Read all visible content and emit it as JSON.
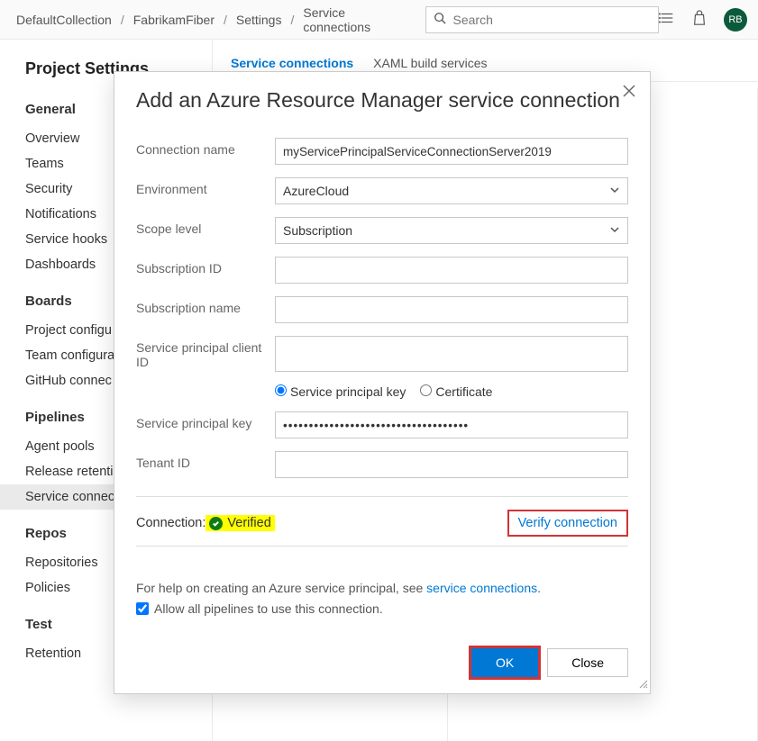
{
  "breadcrumbs": [
    "DefaultCollection",
    "FabrikamFiber",
    "Settings",
    "Service connections"
  ],
  "search": {
    "placeholder": "Search"
  },
  "avatar_initials": "RB",
  "sidebar": {
    "title": "Project Settings",
    "groups": [
      {
        "label": "General",
        "items": [
          "Overview",
          "Teams",
          "Security",
          "Notifications",
          "Service hooks",
          "Dashboards"
        ]
      },
      {
        "label": "Boards",
        "items": [
          "Project configu",
          "Team configura",
          "GitHub connec"
        ]
      },
      {
        "label": "Pipelines",
        "items": [
          "Agent pools",
          "Release retenti",
          "Service connec"
        ]
      },
      {
        "label": "Repos",
        "items": [
          "Repositories",
          "Policies"
        ]
      },
      {
        "label": "Test",
        "items": [
          "Retention"
        ]
      }
    ],
    "selected": "Service connec"
  },
  "tabs": {
    "items": [
      "Service connections",
      "XAML build services"
    ],
    "active": 0
  },
  "dialog": {
    "title": "Add an Azure Resource Manager service connection",
    "fields": {
      "connection_name": {
        "label": "Connection name",
        "value": "myServicePrincipalServiceConnectionServer2019"
      },
      "environment": {
        "label": "Environment",
        "value": "AzureCloud"
      },
      "scope_level": {
        "label": "Scope level",
        "value": "Subscription"
      },
      "subscription_id": {
        "label": "Subscription ID",
        "value": ""
      },
      "subscription_name": {
        "label": "Subscription name",
        "value": ""
      },
      "sp_client_id": {
        "label": "Service principal client ID",
        "value": ""
      },
      "auth_radio": {
        "opt1": "Service principal key",
        "opt2": "Certificate"
      },
      "sp_key": {
        "label": "Service principal key",
        "value": "••••••••••••••••••••••••••••••••••••"
      },
      "tenant_id": {
        "label": "Tenant ID",
        "value": ""
      }
    },
    "connection": {
      "label": "Connection:",
      "status": "Verified",
      "verify_btn": "Verify connection"
    },
    "help": {
      "pre": "For help on creating an Azure service principal, see ",
      "link": "service connections",
      "post": "."
    },
    "allow_label": "Allow all pipelines to use this connection.",
    "buttons": {
      "ok": "OK",
      "close": "Close"
    }
  }
}
